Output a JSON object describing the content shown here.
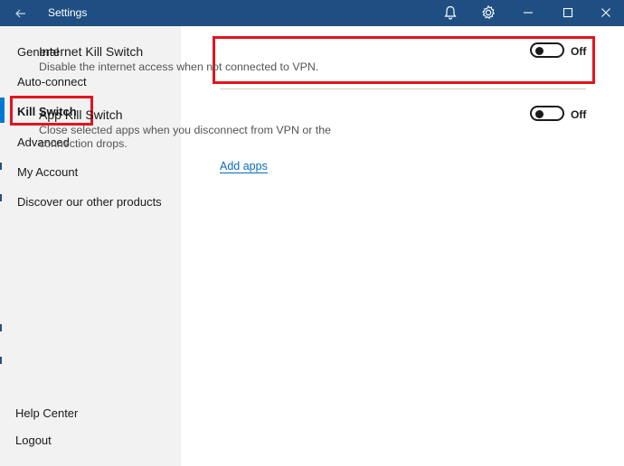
{
  "window": {
    "title": "Settings"
  },
  "sidebar": {
    "items": [
      {
        "label": "General"
      },
      {
        "label": "Auto-connect"
      },
      {
        "label": "Kill Switch",
        "active": true
      },
      {
        "label": "Advanced"
      },
      {
        "label": "My Account"
      },
      {
        "label": "Discover our other products"
      }
    ],
    "bottom": [
      {
        "label": "Help Center"
      },
      {
        "label": "Logout"
      }
    ]
  },
  "content": {
    "internet_kill_switch": {
      "title": "Internet Kill Switch",
      "description": "Disable the internet access when not connected to VPN.",
      "state": "Off"
    },
    "app_kill_switch": {
      "title": "App Kill Switch",
      "description": "Close selected apps when you disconnect from VPN or the connection drops.",
      "state": "Off",
      "add_apps_link": "Add apps"
    }
  },
  "colors": {
    "titlebar": "#1f4f82",
    "sidebar": "#f2f2f2",
    "accent": "#0078d7",
    "highlight": "#e3141d",
    "link": "#0b6bb5"
  },
  "icons": [
    "back-arrow-icon",
    "bell-icon",
    "gear-icon",
    "minimize-icon",
    "maximize-icon",
    "close-icon"
  ]
}
